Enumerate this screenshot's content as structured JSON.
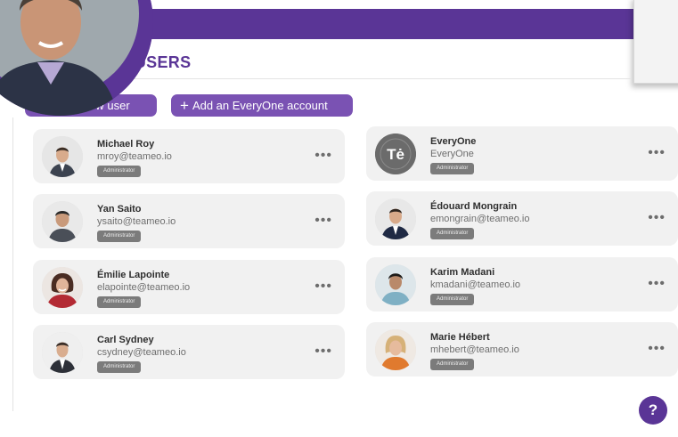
{
  "header": {
    "title": "APP USERS"
  },
  "actions": {
    "add_user_label": "dd a new user",
    "add_everyone_label": "Add an EveryOne account",
    "plus_icon": "plus-icon"
  },
  "colors": {
    "brand_purple": "#5a3596",
    "button_purple": "#7a52b3",
    "card_bg": "#f1f1f1",
    "badge_bg": "#7b7b7b"
  },
  "users_left": [
    {
      "name": "Michael Roy",
      "email": "mroy@teameo.io",
      "role": "Administrator",
      "menu": "•••"
    },
    {
      "name": "Yan Saito",
      "email": "ysaito@teameo.io",
      "role": "Administrator",
      "menu": "•••"
    },
    {
      "name": "Émilie Lapointe",
      "email": "elapointe@teameo.io",
      "role": "Administrator",
      "menu": "•••"
    },
    {
      "name": "Carl Sydney",
      "email": "csydney@teameo.io",
      "role": "Administrator",
      "menu": "•••"
    }
  ],
  "users_right": [
    {
      "name": "EveryOne",
      "email": "EveryOne",
      "role": "Administrator",
      "menu": "•••",
      "logo_text": "Tė"
    },
    {
      "name": "Édouard Mongrain",
      "email": "emongrain@teameo.io",
      "role": "Administrator",
      "menu": "•••"
    },
    {
      "name": "Karim Madani",
      "email": "kmadani@teameo.io",
      "role": "Administrator",
      "menu": "•••"
    },
    {
      "name": "Marie Hébert",
      "email": "mhebert@teameo.io",
      "role": "Administrator",
      "menu": "•••"
    }
  ],
  "help": {
    "label": "?"
  }
}
